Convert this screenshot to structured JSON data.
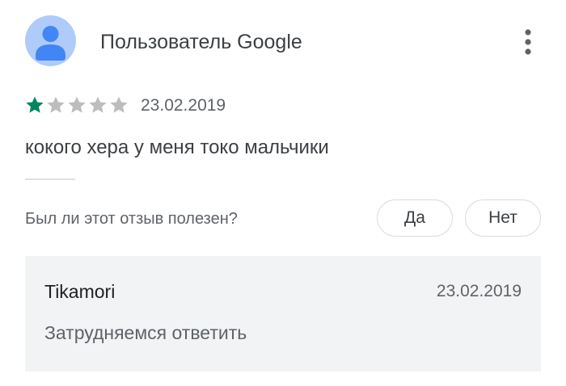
{
  "review": {
    "author": "Пользователь Google",
    "avatar_icon": "person-icon",
    "menu_icon": "more-vert-icon",
    "rating": 1,
    "rating_max": 5,
    "date": "23.02.2019",
    "text": "кокого хера у меня токо мальчики"
  },
  "helpful": {
    "question": "Был ли этот отзыв полезен?",
    "yes_label": "Да",
    "no_label": "Нет"
  },
  "developer_reply": {
    "author": "Tikamori",
    "date": "23.02.2019",
    "text": "Затрудняемся ответить"
  },
  "colors": {
    "star_filled": "#01875f",
    "star_empty": "#bdbdbd",
    "avatar_bg": "#aecbfa",
    "avatar_fg": "#4285f4",
    "reply_bg": "#f1f3f4"
  }
}
